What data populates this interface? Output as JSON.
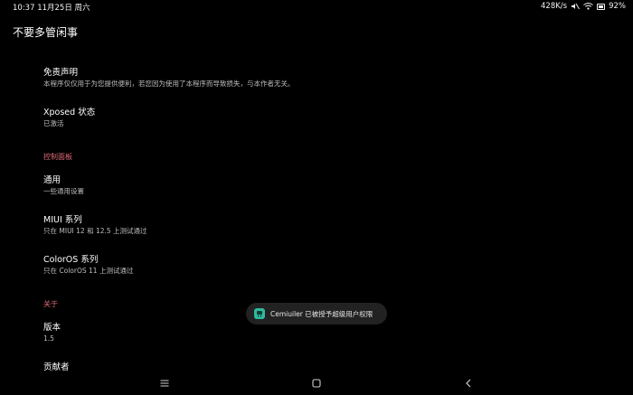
{
  "status_bar": {
    "time": "10:37",
    "date": "11月25日 周六",
    "net_speed": "428K/s",
    "battery_percent": "92"
  },
  "app": {
    "title": "不要多管闲事"
  },
  "items": [
    {
      "title": "免责声明",
      "summary": "本程序仅仅用于为您提供便利，若您因为使用了本程序而导致损失，与本作者无关。"
    },
    {
      "title": "Xposed 状态",
      "summary": "已激活"
    }
  ],
  "sections": [
    {
      "header": "控制面板",
      "items": [
        {
          "title": "通用",
          "summary": "一些通用设置"
        },
        {
          "title": "MIUI 系列",
          "summary": "只在 MIUI 12 和 12.5 上测试通过"
        },
        {
          "title": "ColorOS 系列",
          "summary": "只在 ColorOS 11 上测试通过"
        }
      ]
    },
    {
      "header": "关于",
      "items": [
        {
          "title": "版本",
          "summary": "1.5"
        },
        {
          "title": "贡献者",
          "summary": ""
        }
      ]
    }
  ],
  "toast": {
    "text": "Cemiuiler 已被授予超级用户权限",
    "icon": "app-icon"
  },
  "nav_bar": {
    "icons": [
      "menu-icon",
      "home-icon",
      "back-icon"
    ]
  }
}
